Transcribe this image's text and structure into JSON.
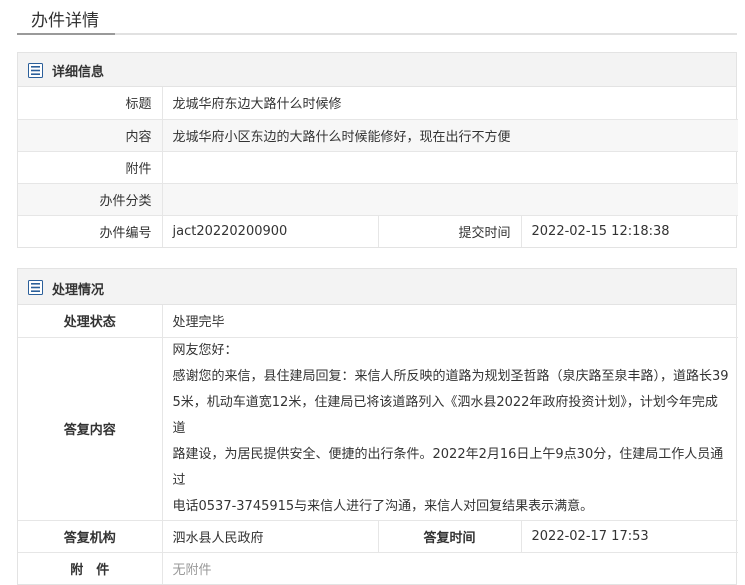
{
  "page": {
    "title": "办件详情"
  },
  "detail": {
    "section_title": "详细信息",
    "title_label": "标题",
    "title_value": "龙城华府东边大路什么时候修",
    "content_label": "内容",
    "content_value": "龙城华府小区东边的大路什么时候能修好，现在出行不方便",
    "attachment_label": "附件",
    "attachment_value": "",
    "category_label": "办件分类",
    "category_value": "",
    "number_label": "办件编号",
    "number_value": "jact20220200900",
    "submit_time_label": "提交时间",
    "submit_time_value": "2022-02-15 12:18:38"
  },
  "handling": {
    "section_title": "处理情况",
    "status_label": "处理状态",
    "status_value": "处理完毕",
    "reply_label": "答复内容",
    "reply_lines": [
      "网友您好：",
      "感谢您的来信，县住建局回复：来信人所反映的道路为规划圣哲路（泉庆路至泉丰路），道路长39",
      "5米，机动车道宽12米，住建局已将该道路列入《泗水县2022年政府投资计划》，计划今年完成道",
      "路建设，为居民提供安全、便捷的出行条件。2022年2月16日上午9点30分，住建局工作人员通过",
      "电话0537-3745915与来信人进行了沟通，来信人对回复结果表示满意。"
    ],
    "org_label": "答复机构",
    "org_value": "泗水县人民政府",
    "reply_time_label": "答复时间",
    "reply_time_value": "2022-02-17 17:53",
    "attachment_label": "附　件",
    "attachment_value": "无附件"
  },
  "icons": {
    "section_icon": "document-list-icon",
    "icon_color": "#2b5f9a"
  }
}
